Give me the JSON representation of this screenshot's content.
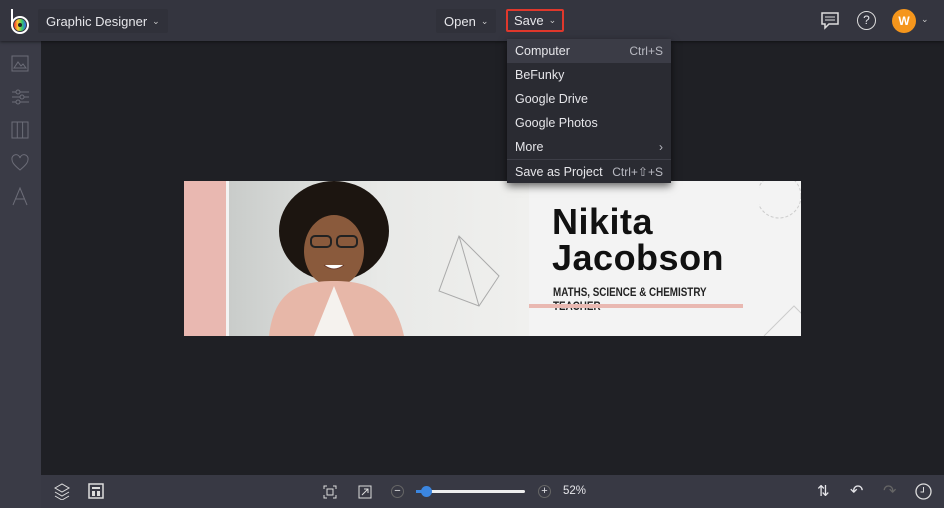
{
  "header": {
    "workspace": "Graphic Designer",
    "open_label": "Open",
    "save_label": "Save",
    "avatar_initial": "W"
  },
  "save_menu": {
    "items": [
      {
        "label": "Computer",
        "shortcut": "Ctrl+S"
      },
      {
        "label": "BeFunky",
        "shortcut": ""
      },
      {
        "label": "Google Drive",
        "shortcut": ""
      },
      {
        "label": "Google Photos",
        "shortcut": ""
      },
      {
        "label": "More",
        "shortcut": "›"
      },
      {
        "label": "Save as Project",
        "shortcut": "Ctrl+⇧+S"
      }
    ]
  },
  "sidebar": {
    "items": [
      "image-icon",
      "sliders-icon",
      "layout-icon",
      "heart-icon",
      "text-icon"
    ]
  },
  "banner": {
    "first_name": "Nikita",
    "last_name": "Jacobson",
    "subtitle": "MATHS, SCIENCE & CHEMISTRY TEACHER"
  },
  "footer": {
    "zoom": "52%",
    "zoom_fraction": 0.1
  },
  "colors": {
    "accent": "#3b86e0",
    "save_outline": "#e0382c",
    "avatar": "#f5961c",
    "pink": "#e9b8b1"
  }
}
